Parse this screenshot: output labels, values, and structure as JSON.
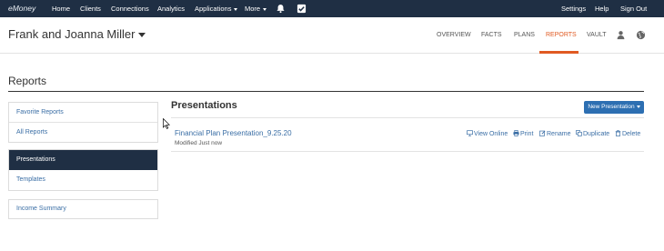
{
  "topnav": {
    "logo": "eMoney",
    "items": [
      "Home",
      "Clients",
      "Connections",
      "Analytics",
      "Applications",
      "More"
    ],
    "right": [
      "Settings",
      "Help",
      "Sign Out"
    ],
    "icons": [
      "bell-icon",
      "checkbox-icon"
    ]
  },
  "client": {
    "name": "Frank and Joanna Miller",
    "tabs": [
      "OVERVIEW",
      "FACTS",
      "PLANS",
      "REPORTS",
      "VAULT"
    ],
    "active_tab": "REPORTS",
    "icons": [
      "person-icon",
      "globe-icon"
    ]
  },
  "page": {
    "title": "Reports"
  },
  "sidebar": {
    "group1": [
      "Favorite Reports",
      "All Reports"
    ],
    "group2": [
      "Presentations",
      "Templates"
    ],
    "group3": [
      "Income Summary"
    ],
    "active": "Presentations"
  },
  "main": {
    "section_title": "Presentations",
    "new_button": "New Presentation",
    "presentation": {
      "name": "Financial Plan Presentation_9.25.20",
      "modified": "Modified Just now"
    },
    "actions": [
      "View Online",
      "Print",
      "Rename",
      "Duplicate",
      "Delete"
    ]
  },
  "colors": {
    "nav_bg": "#1f2f44",
    "accent": "#e05a22",
    "link": "#3a6ea5",
    "button": "#2d6fb2"
  }
}
